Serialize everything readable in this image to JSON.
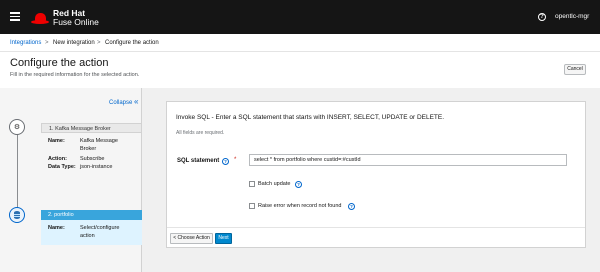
{
  "topbar": {
    "brand_line1": "Red Hat",
    "brand_line2": "Fuse Online",
    "help_icon": "question-circle-icon",
    "user": "opentlc-mgr"
  },
  "breadcrumb": {
    "items": [
      "Integrations",
      "New integration",
      "Configure the action"
    ],
    "separator": ">"
  },
  "header": {
    "title": "Configure the action",
    "subtitle": "Fill in the required information for the selected action.",
    "cancel_label": "Cancel"
  },
  "sidebar": {
    "collapse_label": "Collapse",
    "collapse_icon": "double-chevron-left-icon",
    "steps": [
      {
        "title": "1. Kafka Message Broker",
        "icon": "kafka-icon",
        "fields": [
          {
            "k": "Name:",
            "v": "Kafka Message Broker"
          },
          {
            "k": "Action:",
            "v": "Subscribe"
          },
          {
            "k": "Data Type:",
            "v": "json-instance"
          }
        ]
      },
      {
        "title": "2. portfolio",
        "icon": "database-icon",
        "fields": [
          {
            "k": "Name:",
            "v": "Select/configure action"
          }
        ]
      }
    ]
  },
  "panel": {
    "title": "Invoke SQL - Enter a SQL statement that starts with INSERT, SELECT, UPDATE or DELETE.",
    "note": "All fields are required.",
    "sql_label": "SQL statement",
    "required_mark": "*",
    "sql_value": "select * from portfolio where custid=:#custId",
    "batch_label": "Batch update",
    "raise_label": "Raise error when record not found",
    "choose_label": "< Choose Action",
    "next_label": "Next"
  },
  "colors": {
    "accent": "#0066cc",
    "brand_red": "#ee0000",
    "active_step": "#39a5dc",
    "primary_button": "#0088ce"
  }
}
